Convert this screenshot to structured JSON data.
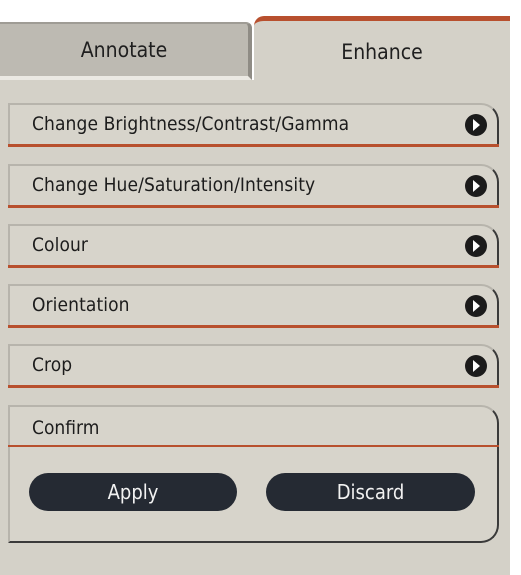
{
  "tabs": {
    "annotate_label": "Annotate",
    "enhance_label": "Enhance",
    "active": "Enhance"
  },
  "sections": [
    {
      "label": "Change Brightness/Contrast/Gamma",
      "icon": "chevron-right-icon"
    },
    {
      "label": "Change Hue/Saturation/Intensity",
      "icon": "chevron-right-icon"
    },
    {
      "label": "Colour",
      "icon": "chevron-right-icon"
    },
    {
      "label": "Orientation",
      "icon": "chevron-right-icon"
    },
    {
      "label": "Crop",
      "icon": "chevron-right-icon"
    }
  ],
  "confirm": {
    "title": "Confirm",
    "apply_label": "Apply",
    "discard_label": "Discard"
  },
  "colors": {
    "accent": "#b8502e",
    "panel": "#d4d1c8",
    "button": "#252a33"
  }
}
